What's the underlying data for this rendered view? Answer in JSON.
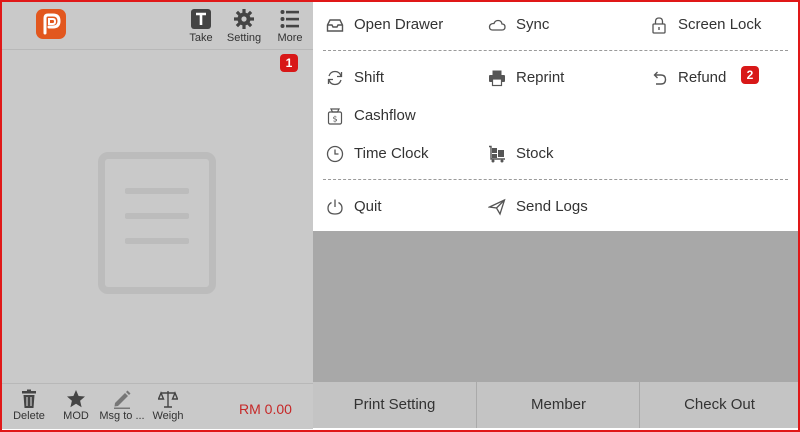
{
  "toolbar": {
    "take_label": "Take",
    "setting_label": "Setting",
    "more_label": "More",
    "more_badge": "1"
  },
  "cart": {
    "delete_label": "Delete",
    "mod_label": "MOD",
    "msg_label": "Msg to ...",
    "weigh_label": "Weigh",
    "total": "RM 0.00"
  },
  "menu": {
    "open_drawer": "Open Drawer",
    "sync": "Sync",
    "screen_lock": "Screen Lock",
    "shift": "Shift",
    "reprint": "Reprint",
    "refund": "Refund",
    "refund_badge": "2",
    "cashflow": "Cashflow",
    "time_clock": "Time Clock",
    "stock": "Stock",
    "quit": "Quit",
    "send_logs": "Send Logs"
  },
  "actions": {
    "print_setting": "Print Setting",
    "member": "Member",
    "check_out": "Check Out"
  },
  "colors": {
    "brand": "#e2571e",
    "badge": "#d81818",
    "total": "#c62828",
    "highlight_border": "#e01818"
  }
}
